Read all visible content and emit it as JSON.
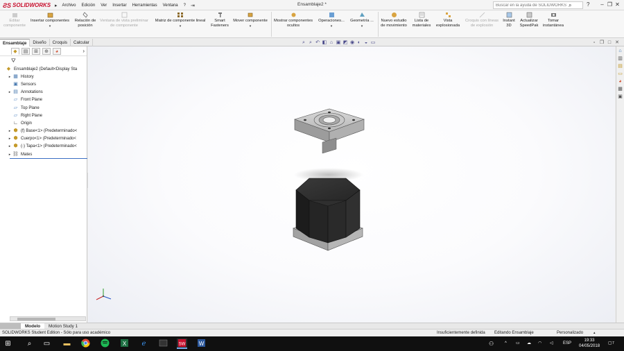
{
  "app": {
    "logo": "SOLIDWORKS",
    "document_title": "Ensamblaje2 *"
  },
  "menu": [
    "Archivo",
    "Edición",
    "Ver",
    "Insertar",
    "Herramientas",
    "Ventana",
    "?"
  ],
  "search": {
    "placeholder": "Buscar en la ayuda de SOLIDWORKS"
  },
  "ribbon": [
    {
      "label": "Editar componente",
      "disabled": true
    },
    {
      "label": "Insertar componentes",
      "disabled": false
    },
    {
      "label": "Relación de posición",
      "disabled": false
    },
    {
      "label": "Ventana de vista preliminar de componente",
      "disabled": true
    },
    {
      "label": "Matriz de componente lineal",
      "disabled": false
    },
    {
      "label": "Smart Fasteners",
      "disabled": false
    },
    {
      "label": "Mover componente",
      "disabled": false
    },
    {
      "label": "Mostrar componentes ocultos",
      "disabled": false
    },
    {
      "label": "Operaciones...",
      "disabled": false
    },
    {
      "label": "Geometría ...",
      "disabled": false
    },
    {
      "label": "Nuevo estudio de movimiento",
      "disabled": false
    },
    {
      "label": "Lista de materiales",
      "disabled": false
    },
    {
      "label": "Vista explosionada",
      "disabled": false
    },
    {
      "label": "Croquis con líneas de explosión",
      "disabled": true
    },
    {
      "label": "Instant 3D",
      "disabled": false
    },
    {
      "label": "Actualizar SpeedPak",
      "disabled": false
    },
    {
      "label": "Tomar instantánea",
      "disabled": false
    }
  ],
  "command_tabs": [
    "Ensamblaje",
    "Diseño",
    "Croquis",
    "Calcular"
  ],
  "tree": [
    {
      "label": "Ensamblaje2  (Default<Display Sta",
      "expand": "",
      "icon": "assembly-icon"
    },
    {
      "label": "History",
      "expand": "▸",
      "icon": "history-icon"
    },
    {
      "label": "Sensors",
      "expand": "",
      "icon": "sensors-icon"
    },
    {
      "label": "Annotations",
      "expand": "▸",
      "icon": "annotations-icon"
    },
    {
      "label": "Front Plane",
      "expand": "",
      "icon": "plane-icon"
    },
    {
      "label": "Top Plane",
      "expand": "",
      "icon": "plane-icon"
    },
    {
      "label": "Right Plane",
      "expand": "",
      "icon": "plane-icon"
    },
    {
      "label": "Origin",
      "expand": "",
      "icon": "origin-icon"
    },
    {
      "label": "(f) Base<1> (Predeterminado<",
      "expand": "▸",
      "icon": "part-icon"
    },
    {
      "label": "Cuerpo<1> (Predeterminado<",
      "expand": "▸",
      "icon": "part-icon"
    },
    {
      "label": "(-) Tapa<1> (Predeterminado<",
      "expand": "▸",
      "icon": "part-icon"
    },
    {
      "label": "Mates",
      "expand": "▸",
      "icon": "mates-icon"
    }
  ],
  "bottom_tabs": [
    "Modelo",
    "Motion Study 1"
  ],
  "status": {
    "left": "SOLIDWORKS Student Edition - Sólo para uso académico",
    "definition": "Insuficientemente definida",
    "mode": "Editando Ensamblaje",
    "custom": "Personalizado"
  },
  "taskbar": {
    "lang": "ESP",
    "time": "19:33",
    "date": "04/05/2018",
    "notifications": "7"
  },
  "colors": {
    "brand": "#c8102e",
    "accent": "#3a6ec4"
  }
}
